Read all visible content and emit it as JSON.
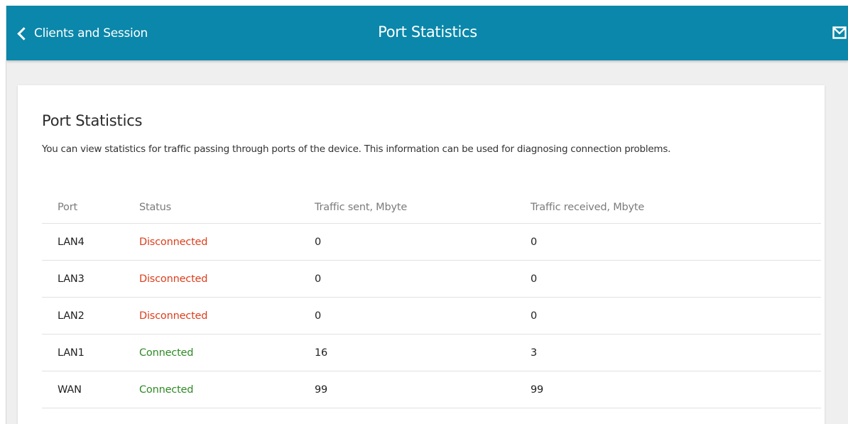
{
  "header": {
    "back_label": "Clients and Session",
    "title": "Port Statistics",
    "back_icon": "chevron-left-icon",
    "mail_icon": "mail-icon",
    "background_color": "#0a87aa"
  },
  "card": {
    "title": "Port Statistics",
    "description": "You can view statistics for traffic passing through ports of the device. This information can be used for diagnosing connection problems."
  },
  "table": {
    "columns": [
      "Port",
      "Status",
      "Traffic sent, Mbyte",
      "Traffic received, Mbyte"
    ],
    "rows": [
      {
        "port": "LAN4",
        "status": "Disconnected",
        "sent": "0",
        "received": "0"
      },
      {
        "port": "LAN3",
        "status": "Disconnected",
        "sent": "0",
        "received": "0"
      },
      {
        "port": "LAN2",
        "status": "Disconnected",
        "sent": "0",
        "received": "0"
      },
      {
        "port": "LAN1",
        "status": "Connected",
        "sent": "16",
        "received": "3"
      },
      {
        "port": "WAN",
        "status": "Connected",
        "sent": "99",
        "received": "99"
      }
    ]
  },
  "colors": {
    "disconnected": "#dc3e1c",
    "connected": "#2f8a26"
  }
}
